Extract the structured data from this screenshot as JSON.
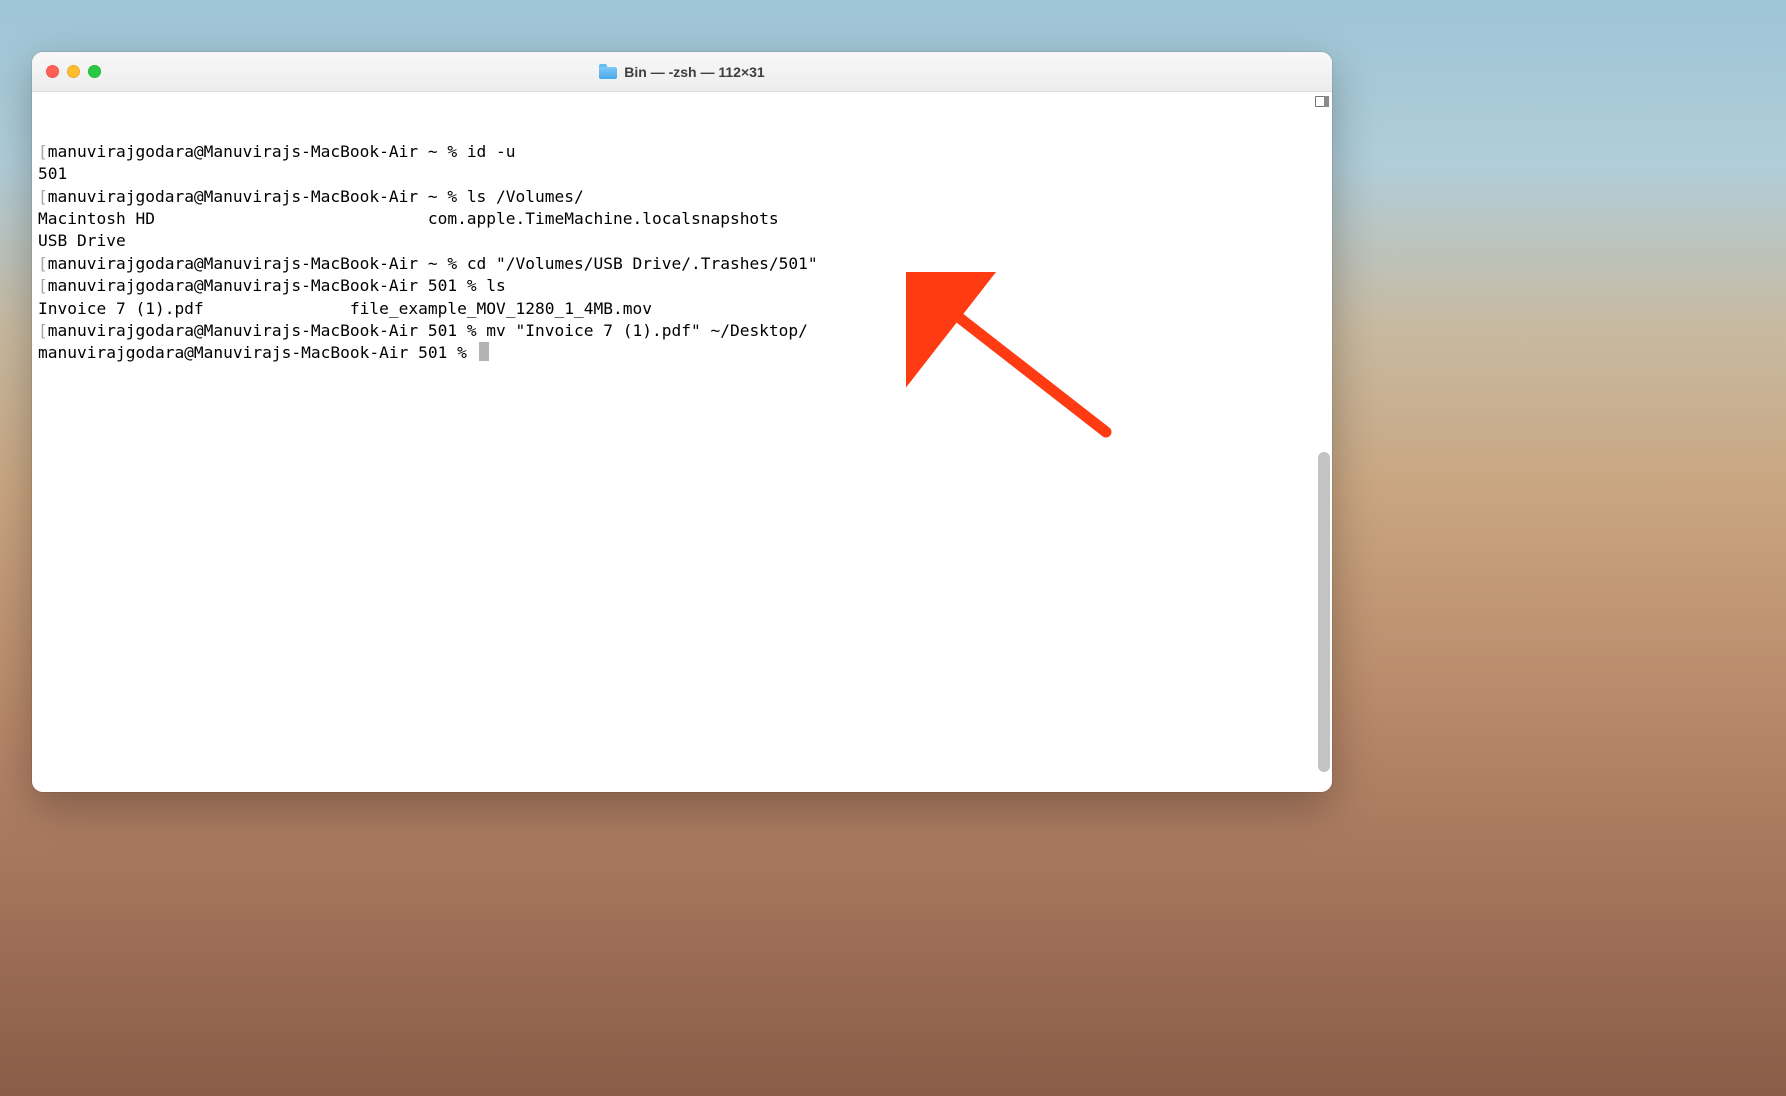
{
  "window": {
    "title": "Bin — -zsh — 112×31"
  },
  "terminal": {
    "lines": [
      {
        "bracket": "[",
        "text": "manuvirajgodara@Manuvirajs-MacBook-Air ~ % id -u"
      },
      {
        "bracket": "",
        "text": "501"
      },
      {
        "bracket": "[",
        "text": "manuvirajgodara@Manuvirajs-MacBook-Air ~ % ls /Volumes/"
      },
      {
        "bracket": "",
        "text": "Macintosh HD                            com.apple.TimeMachine.localsnapshots"
      },
      {
        "bracket": "",
        "text": "USB Drive"
      },
      {
        "bracket": "[",
        "text": "manuvirajgodara@Manuvirajs-MacBook-Air ~ % cd \"/Volumes/USB Drive/.Trashes/501\""
      },
      {
        "bracket": "[",
        "text": "manuvirajgodara@Manuvirajs-MacBook-Air 501 % ls"
      },
      {
        "bracket": "",
        "text": "Invoice 7 (1).pdf               file_example_MOV_1280_1_4MB.mov"
      },
      {
        "bracket": "[",
        "text": "manuvirajgodara@Manuvirajs-MacBook-Air 501 % mv \"Invoice 7 (1).pdf\" ~/Desktop/"
      },
      {
        "bracket": "",
        "text": "manuvirajgodara@Manuvirajs-MacBook-Air 501 % ",
        "cursor": true
      }
    ]
  }
}
